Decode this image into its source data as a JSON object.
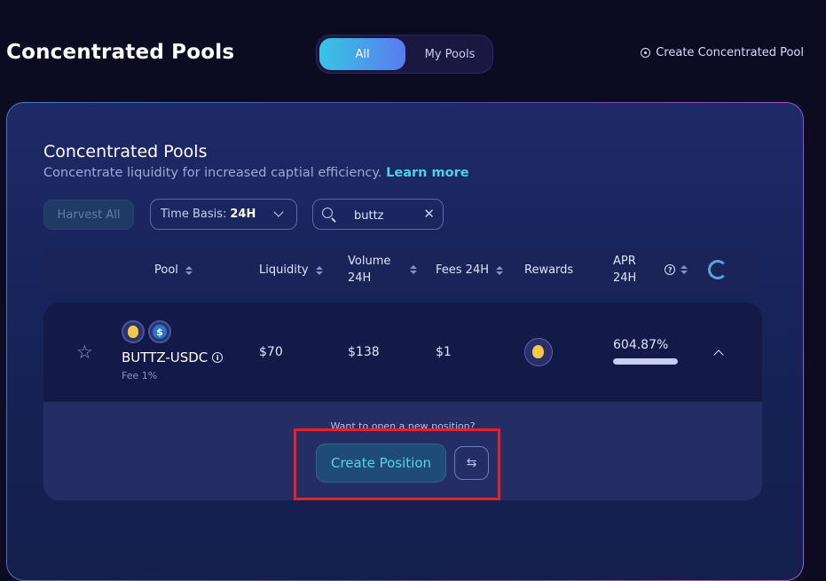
{
  "page": {
    "title": "Concentrated Pools"
  },
  "toggle": {
    "all": "All",
    "my_pools": "My Pools",
    "active": "All"
  },
  "create_pool": {
    "label": "Create Concentrated Pool",
    "icon": "plus-circle-icon"
  },
  "panel": {
    "title": "Concentrated Pools",
    "subtitle": "Concentrate liquidity for increased captial efficiency.",
    "learn_more": "Learn more"
  },
  "controls": {
    "harvest_all": "Harvest All",
    "time_basis_label": "Time Basis:",
    "time_basis_value": "24H",
    "search_value": "buttz"
  },
  "table": {
    "headers": {
      "pool": "Pool",
      "liquidity": "Liquidity",
      "volume_line1": "Volume",
      "volume_line2": "24H",
      "fees": "Fees 24H",
      "rewards": "Rewards",
      "apr_line1": "APR",
      "apr_line2": "24H"
    },
    "rows": [
      {
        "pair": "BUTTZ-USDC",
        "fee": "Fee 1%",
        "liquidity": "$70",
        "volume": "$138",
        "fees": "$1",
        "apr": "604.87%",
        "apr_fill_fraction": 1.0,
        "token_a_icon": "buttz-token-icon",
        "token_b_icon": "usdc-token-icon",
        "reward_icon": "buttz-token-icon"
      }
    ]
  },
  "expand": {
    "hint": "Want to open a new position?",
    "create_position": "Create Position",
    "swap_icon": "swap-arrows-icon"
  },
  "colors": {
    "background": "#0c0b22",
    "accent": "#4fd0e4",
    "highlight": "#e8202a"
  }
}
